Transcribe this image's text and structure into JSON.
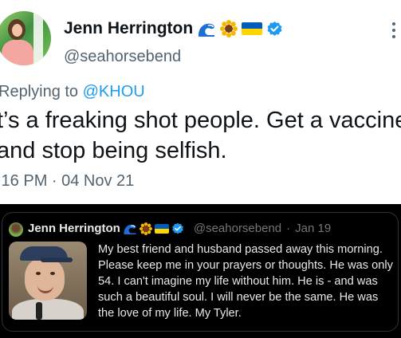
{
  "tweet": {
    "author_name": "Jenn Herrington",
    "handle": "@seahorsebend",
    "replying_prefix": "Replying to ",
    "replying_to": "@KHOU",
    "text": "t’s a freaking shot people. Get a vaccine and stop being selfish.",
    "time": ":16 PM · 04 Nov 21"
  },
  "quoted": {
    "author_name": "Jenn Herrington",
    "handle": "@seahorsebend",
    "separator": "·",
    "date": "Jan 19",
    "text": "My best friend and husband passed away this morning. Please keep me in your prayers or thoughts. He was only 54. I can't imagine my life without him. He is - and was such a beautiful soul. I will never be the same. He was the love of my life. My Tyler."
  },
  "icons": {
    "name_emoji": [
      "wave-icon",
      "sunflower-icon",
      "ukraine-flag-icon"
    ],
    "verified": "verified-badge-icon",
    "more": "more-icon"
  },
  "colors": {
    "accent": "#1d9bf0",
    "flag_blue": "#005bbb",
    "flag_yellow": "#ffd500",
    "secondary_text": "#536471",
    "dark_text": "#e7e9ea"
  }
}
